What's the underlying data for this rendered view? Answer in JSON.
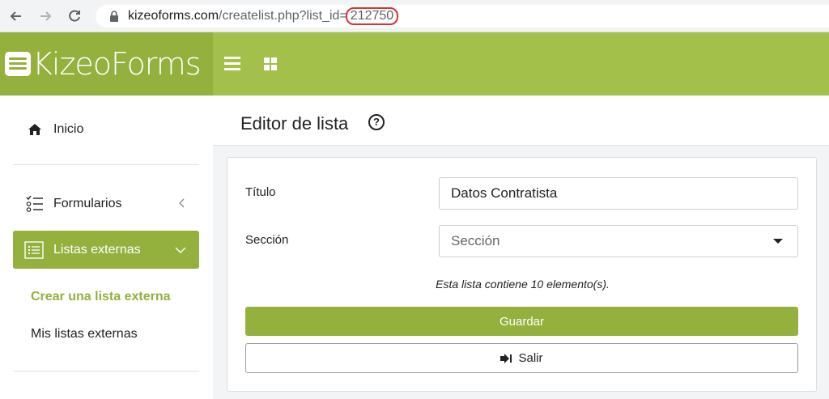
{
  "browser": {
    "url_host": "kizeoforms.com",
    "url_path": "/createlist.php?list_id=",
    "url_id": "212750"
  },
  "app": {
    "logo_text": "KizeoForms",
    "accent_color": "#94b03d",
    "header_color": "#a3c04a"
  },
  "sidebar": {
    "items": [
      {
        "label": "Inicio",
        "icon": "home-icon"
      },
      {
        "label": "Formularios",
        "icon": "checklist-icon"
      },
      {
        "label": "Listas externas",
        "icon": "list-icon"
      }
    ],
    "sub_items": [
      {
        "label": "Crear una lista externa"
      },
      {
        "label": "Mis listas externas"
      }
    ]
  },
  "main": {
    "title": "Editor de lista",
    "form": {
      "title_label": "Título",
      "title_value": "Datos Contratista",
      "section_label": "Sección",
      "section_placeholder": "Sección",
      "info": "Esta lista contiene 10 elemento(s).",
      "save_label": "Guardar",
      "exit_label": "Salir"
    }
  }
}
